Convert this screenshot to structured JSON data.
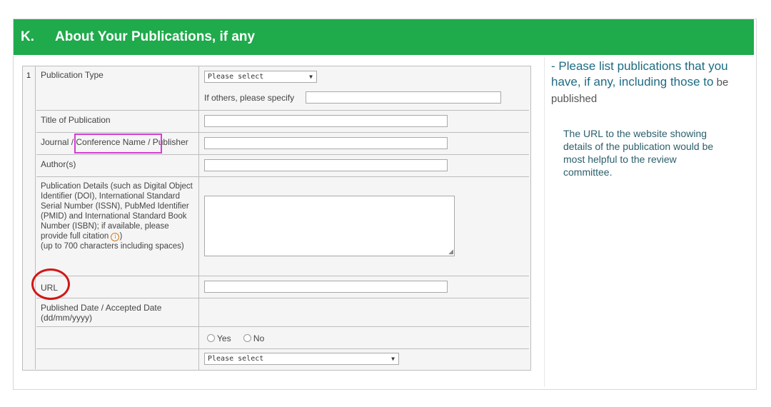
{
  "section": {
    "letter": "K.",
    "title": "About Your Publications, if any"
  },
  "row_number": "1",
  "form": {
    "publication_type": {
      "label": "Publication Type",
      "select_value": "Please select",
      "others_label": "If others, please specify"
    },
    "title": {
      "label": "Title of Publication"
    },
    "journal": {
      "label_a": "Journal / ",
      "label_b": "Conference Name / ",
      "label_c": "Publisher"
    },
    "authors": {
      "label": "Author(s)"
    },
    "details": {
      "label": "Publication Details (such as Digital Object Identifier (DOI), International Standard Serial Number (ISSN), PubMed Identifier (PMID) and International Standard Book Number (ISBN); if available, please provide full citation",
      "label_after": ")",
      "note": "(up to 700 characters including spaces)"
    },
    "url": {
      "label": "URL"
    },
    "published_date": {
      "label": "Published Date / Accepted Date (dd/mm/yyyy)"
    },
    "radio": {
      "yes": "Yes",
      "no": "No"
    },
    "last_select": {
      "value": "Please select"
    }
  },
  "sidebar": {
    "dash": "-",
    "title_main": "Please list publications that you have, if any, including those to",
    "title_tail": " be published",
    "note": "The URL to the website showing details of the publication would be most helpful to the review committee."
  },
  "icons": {
    "info": "info-circle-icon",
    "dropdown": "chevron-down-icon",
    "resize": "resize-grip-icon"
  },
  "colors": {
    "header_bg": "#1faa4b",
    "sidebar_text": "#1d6b82",
    "highlight_pink": "#d63bd6",
    "highlight_red": "#d01818"
  }
}
